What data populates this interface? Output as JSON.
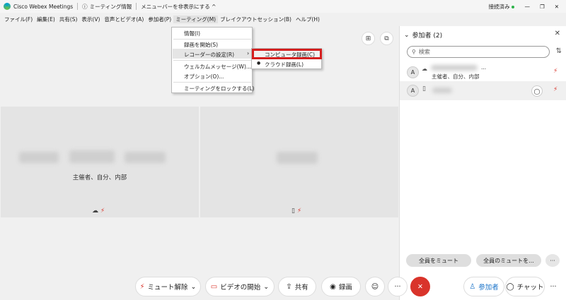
{
  "titlebar": {
    "app_name": "Cisco Webex Meetings",
    "meeting_info": "ミーティング情報",
    "hide_menubar": "メニューバーを非表示にする ^",
    "status": "接続済み"
  },
  "menubar": [
    "ファイル(F)",
    "編集(E)",
    "共有(S)",
    "表示(V)",
    "音声とビデオ(A)",
    "参加者(P)",
    "ミーティング(M)",
    "ブレイクアウトセッション(B)",
    "ヘルプ(H)"
  ],
  "meeting_menu": {
    "items": [
      "情報(I)",
      "録画を開始(S)",
      "レコーダーの設定(R)",
      "ウェルカムメッセージ(W)...",
      "オプション(O)...",
      "ミーティングをロックする(L)"
    ],
    "submenu_arrow": "›",
    "submenu": [
      "コンピュータ録画(C)",
      "クラウド録画(L)"
    ]
  },
  "tiles": {
    "main_role": "主催者、自分、内部"
  },
  "panel": {
    "title": "参加者 (2)",
    "search_placeholder": "検索",
    "participants": [
      {
        "initial": "A",
        "role": "主催者、自分、内部",
        "suffix": "..."
      },
      {
        "initial": "A",
        "role": "",
        "suffix": ""
      }
    ],
    "mute_all": "全員をミュート",
    "unmute_all": "全員のミュートを...",
    "more": "···"
  },
  "toolbar": {
    "unmute": "ミュート解除",
    "start_video": "ビデオの開始",
    "share": "共有",
    "record": "録画",
    "more": "···",
    "participants": "参加者",
    "chat": "チャット",
    "chevron": "⌄",
    "leave_icon": "✕"
  },
  "colors": {
    "accent_red": "#d9342b",
    "highlight_box": "#d51f1f",
    "connected_green": "#2db34a"
  }
}
